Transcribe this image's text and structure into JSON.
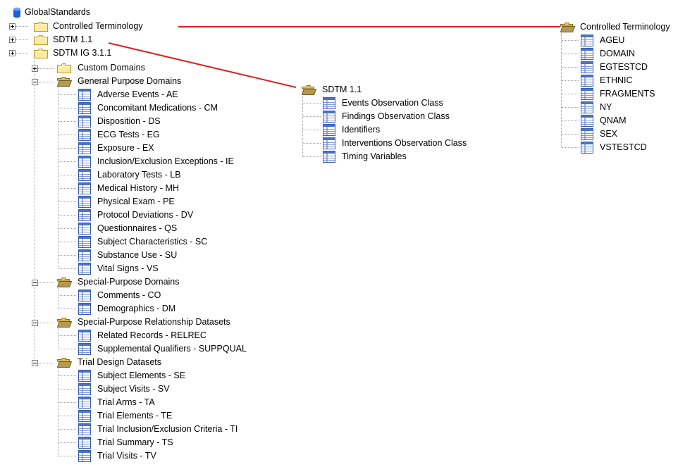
{
  "root": "GlobalStandards",
  "left_tree": {
    "controlled_terminology": "Controlled Terminology",
    "sdtm_1_1": "SDTM 1.1",
    "sdtm_ig": "SDTM IG 3.1.1",
    "custom_domains": "Custom Domains",
    "general_purpose": {
      "label": "General Purpose Domains",
      "items": [
        "Adverse Events - AE",
        "Concomitant Medications - CM",
        "Disposition - DS",
        "ECG Tests - EG",
        "Exposure - EX",
        "Inclusion/Exclusion Exceptions - IE",
        "Laboratory Tests - LB",
        "Medical History - MH",
        "Physical Exam - PE",
        "Protocol Deviations - DV",
        "Questionnaires - QS",
        "Subject Characteristics - SC",
        "Substance Use - SU",
        "Vital Signs - VS"
      ]
    },
    "special_purpose": {
      "label": "Special-Purpose Domains",
      "items": [
        "Comments - CO",
        "Demographics - DM"
      ]
    },
    "relationship": {
      "label": "Special-Purpose Relationship Datasets",
      "items": [
        "Related Records - RELREC",
        "Supplemental Qualifiers - SUPPQUAL"
      ]
    },
    "trial_design": {
      "label": "Trial Design Datasets",
      "items": [
        "Subject Elements - SE",
        "Subject Visits - SV",
        "Trial Arms - TA",
        "Trial Elements - TE",
        "Trial Inclusion/Exclusion Criteria - TI",
        "Trial Summary - TS",
        "Trial Visits - TV"
      ]
    }
  },
  "sdtm_panel": {
    "label": "SDTM 1.1",
    "items": [
      "Events Observation Class",
      "Findings Observation Class",
      "Identifiers",
      "Interventions Observation Class",
      "Timing Variables"
    ]
  },
  "ct_panel": {
    "label": "Controlled Terminology",
    "items": [
      "AGEU",
      "DOMAIN",
      "EGTESTCD",
      "ETHNIC",
      "FRAGMENTS",
      "NY",
      "QNAM",
      "SEX",
      "VSTESTCD"
    ]
  },
  "colors": {
    "connector": "#e02020",
    "folder": "#f5e08a",
    "folder_edge": "#b89a30"
  }
}
